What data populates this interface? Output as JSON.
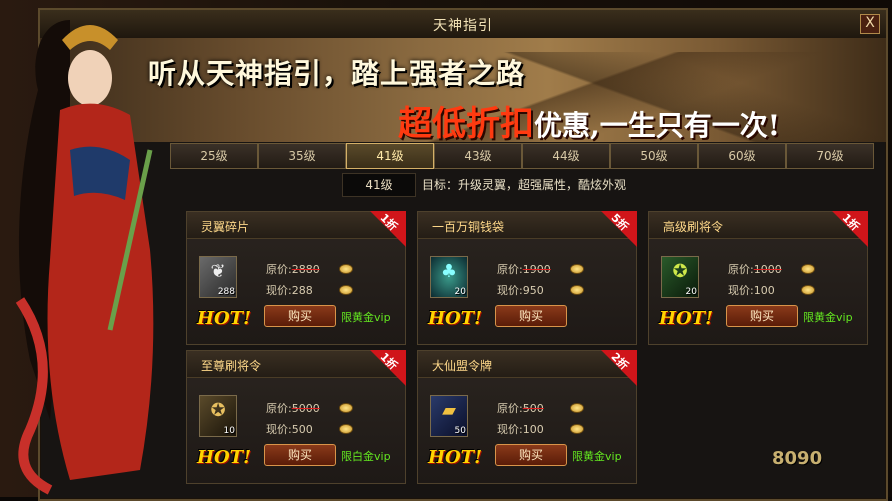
{
  "window": {
    "title": "天神指引",
    "close_label": "X"
  },
  "banner": {
    "slogan_line1": "听从天神指引，踏上强者之路",
    "slogan_red": "超低折扣",
    "slogan_white": "优惠,一生只有一次!"
  },
  "tabs": [
    {
      "label": "25级"
    },
    {
      "label": "35级"
    },
    {
      "label": "41级",
      "active": true
    },
    {
      "label": "43级"
    },
    {
      "label": "44级"
    },
    {
      "label": "50级"
    },
    {
      "label": "60级"
    },
    {
      "label": "70级"
    }
  ],
  "goal": {
    "level": "41级",
    "text": "目标：升级灵翼，超强属性，酷炫外观"
  },
  "cards": [
    {
      "name": "灵翼碎片",
      "discount": "1折",
      "count": "288",
      "orig_label": "原价:",
      "orig_value": "2880",
      "now_label": "现价:",
      "now_value": "288",
      "hot": "HOT!",
      "buy": "购买",
      "limit": "限黄金vip",
      "icon": "feather-icon"
    },
    {
      "name": "一百万铜钱袋",
      "discount": "5折",
      "count": "20",
      "orig_label": "原价:",
      "orig_value": "1900",
      "now_label": "现价:",
      "now_value": "950",
      "hot": "HOT!",
      "buy": "购买",
      "limit": "",
      "icon": "money-bag-icon"
    },
    {
      "name": "高级刷将令",
      "discount": "1折",
      "count": "20",
      "orig_label": "原价:",
      "orig_value": "1000",
      "now_label": "现价:",
      "now_value": "100",
      "hot": "HOT!",
      "buy": "购买",
      "limit": "限黄金vip",
      "icon": "token-icon"
    },
    {
      "name": "至尊刷将令",
      "discount": "1折",
      "count": "10",
      "orig_label": "原价:",
      "orig_value": "5000",
      "now_label": "现价:",
      "now_value": "500",
      "hot": "HOT!",
      "buy": "购买",
      "limit": "限白金vip",
      "icon": "token-icon"
    },
    {
      "name": "大仙盟令牌",
      "discount": "2折",
      "count": "50",
      "orig_label": "原价:",
      "orig_value": "500",
      "now_label": "现价:",
      "now_value": "100",
      "hot": "HOT!",
      "buy": "购买",
      "limit": "限黄金vip",
      "icon": "plaque-icon"
    }
  ],
  "watermark": "8090"
}
